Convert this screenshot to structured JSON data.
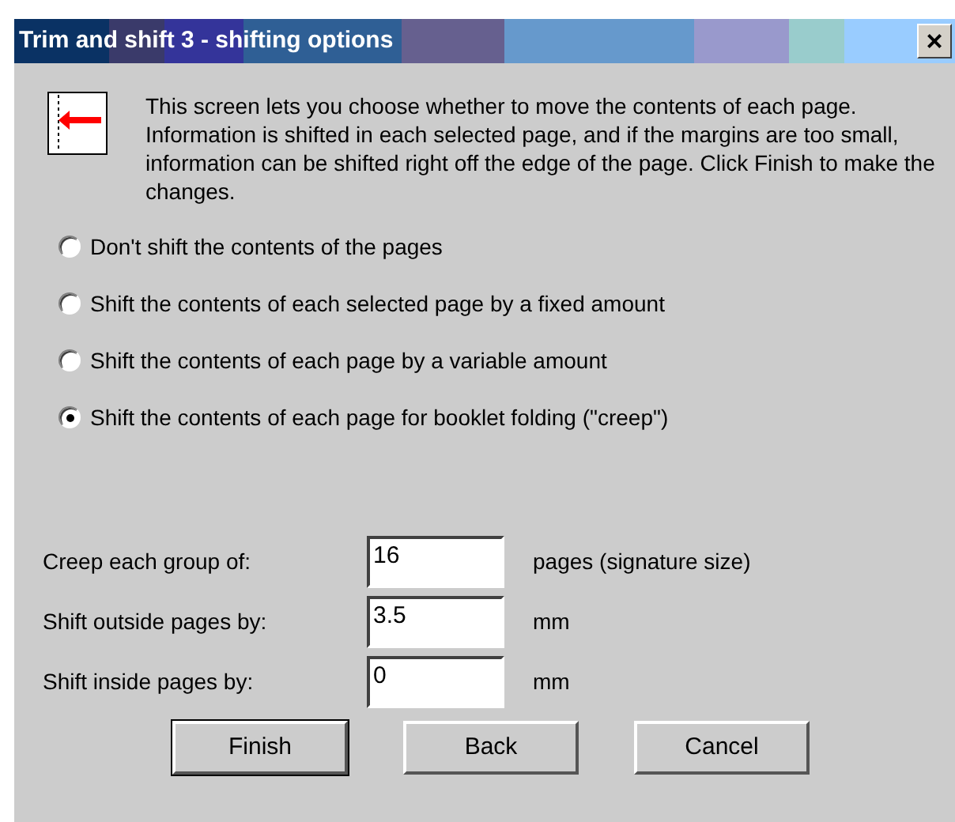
{
  "window": {
    "title": "Trim and shift 3 - shifting options",
    "close": "×"
  },
  "description": "This screen lets you choose whether to move the contents of each page. Information is shifted in each selected page, and if the margins are too small, information can be shifted right off the edge of the page. Click Finish to make the changes.",
  "options": [
    {
      "label": "Don't shift the contents of the pages",
      "selected": false
    },
    {
      "label": "Shift the contents of each selected page by a fixed amount",
      "selected": false
    },
    {
      "label": "Shift the contents of each page by a variable amount",
      "selected": false
    },
    {
      "label": "Shift the contents of each page for booklet folding (\"creep\")",
      "selected": true
    }
  ],
  "fields": [
    {
      "label": "Creep each group of:",
      "value": "16",
      "unit": "pages (signature size)"
    },
    {
      "label": "Shift outside pages by:",
      "value": "3.5",
      "unit": "mm"
    },
    {
      "label": "Shift inside pages by:",
      "value": "0",
      "unit": "mm"
    }
  ],
  "buttons": [
    {
      "label": "Finish",
      "default": true
    },
    {
      "label": "Back",
      "default": false
    },
    {
      "label": "Cancel",
      "default": false
    }
  ]
}
